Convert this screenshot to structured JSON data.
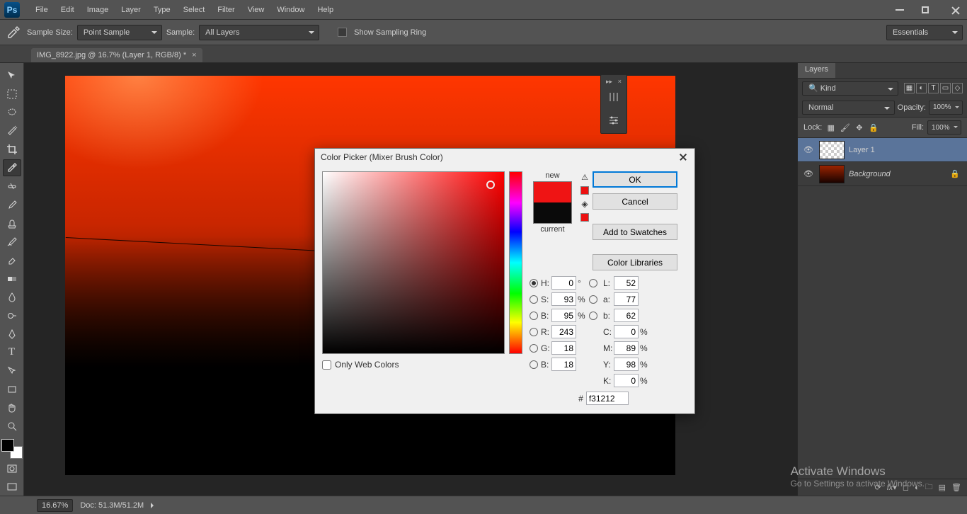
{
  "app_name": "Ps",
  "menu": [
    "File",
    "Edit",
    "Image",
    "Layer",
    "Type",
    "Select",
    "Filter",
    "View",
    "Window",
    "Help"
  ],
  "options": {
    "sample_size_label": "Sample Size:",
    "sample_size_value": "Point Sample",
    "sample_label": "Sample:",
    "sample_value": "All Layers",
    "show_ring": "Show Sampling Ring",
    "workspace": "Essentials"
  },
  "doc_tab": "IMG_8922.jpg @ 16.7% (Layer 1, RGB/8) *",
  "dialog": {
    "title": "Color Picker (Mixer Brush Color)",
    "new_label": "new",
    "current_label": "current",
    "ok": "OK",
    "cancel": "Cancel",
    "add_swatches": "Add to Swatches",
    "color_libraries": "Color Libraries",
    "only_web": "Only Web Colors",
    "hex_label": "#",
    "hex_value": "f31212",
    "new_color": "#ef1414",
    "current_color": "#0a0a0a",
    "fields": {
      "H": {
        "v": "0",
        "u": "°"
      },
      "S": {
        "v": "93",
        "u": "%"
      },
      "B": {
        "v": "95",
        "u": "%"
      },
      "R": {
        "v": "243",
        "u": ""
      },
      "G": {
        "v": "18",
        "u": ""
      },
      "Bl": {
        "v": "18",
        "u": ""
      },
      "L": {
        "v": "52",
        "u": ""
      },
      "a": {
        "v": "77",
        "u": ""
      },
      "b": {
        "v": "62",
        "u": ""
      },
      "C": {
        "v": "0",
        "u": "%"
      },
      "M": {
        "v": "89",
        "u": "%"
      },
      "Y": {
        "v": "98",
        "u": "%"
      },
      "K": {
        "v": "0",
        "u": "%"
      }
    }
  },
  "layers_panel": {
    "tab": "Layers",
    "kind": "Kind",
    "blend": "Normal",
    "opacity_label": "Opacity:",
    "opacity_value": "100%",
    "lock_label": "Lock:",
    "fill_label": "Fill:",
    "fill_value": "100%",
    "rows": [
      {
        "name": "Layer 1",
        "bg": "linear-gradient(#d0d0d0,#a0a0a0)"
      },
      {
        "name": "Background",
        "bg": "linear-gradient(#9a2300,#1a0300)",
        "locked": true
      }
    ]
  },
  "status": {
    "zoom": "16.67%",
    "doc": "Doc: 51.3M/51.2M"
  },
  "watermark": {
    "title": "Activate Windows",
    "sub": "Go to Settings to activate Windows."
  }
}
